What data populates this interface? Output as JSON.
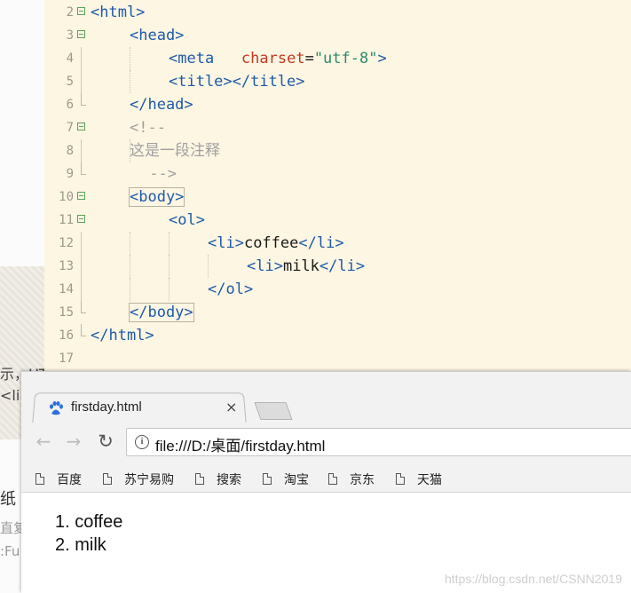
{
  "background": {
    "snippets": [
      "示，HT",
      "<li>",
      "纸",
      "直复",
      ":Fu"
    ]
  },
  "editor": {
    "lines": [
      {
        "num": "2",
        "tokens": [
          {
            "t": "<html>",
            "c": "tag"
          }
        ]
      },
      {
        "num": "3",
        "tokens": [
          {
            "t": "<head>",
            "c": "tag"
          }
        ]
      },
      {
        "num": "4",
        "tokens": [
          {
            "t": "<meta",
            "c": "tag"
          },
          {
            "t": "   ",
            "c": "txt"
          },
          {
            "t": "charset",
            "c": "attr"
          },
          {
            "t": "=",
            "c": "txt"
          },
          {
            "t": "\"utf-8\"",
            "c": "str"
          },
          {
            "t": ">",
            "c": "tag"
          }
        ]
      },
      {
        "num": "5",
        "tokens": [
          {
            "t": "<title></title>",
            "c": "tag"
          }
        ]
      },
      {
        "num": "6",
        "tokens": [
          {
            "t": "</head>",
            "c": "tag"
          }
        ]
      },
      {
        "num": "7",
        "tokens": [
          {
            "t": "<!--",
            "c": "cmt-mono"
          }
        ]
      },
      {
        "num": "8",
        "tokens": [
          {
            "t": "这是一段注释",
            "c": "cmt"
          }
        ]
      },
      {
        "num": "9",
        "tokens": [
          {
            "t": " -->",
            "c": "cmt-mono"
          }
        ]
      },
      {
        "num": "10",
        "tokens": [
          {
            "t": "<body>",
            "c": "tag match"
          }
        ]
      },
      {
        "num": "11",
        "tokens": [
          {
            "t": "<ol>",
            "c": "tag"
          }
        ]
      },
      {
        "num": "12",
        "tokens": [
          {
            "t": "<li>",
            "c": "tag"
          },
          {
            "t": "coffee",
            "c": "txt"
          },
          {
            "t": "</li>",
            "c": "tag"
          }
        ]
      },
      {
        "num": "13",
        "tokens": [
          {
            "t": "<li>",
            "c": "tag"
          },
          {
            "t": "milk",
            "c": "txt"
          },
          {
            "t": "</li>",
            "c": "tag"
          }
        ]
      },
      {
        "num": "14",
        "tokens": [
          {
            "t": "</ol>",
            "c": "tag"
          }
        ]
      },
      {
        "num": "15",
        "tokens": [
          {
            "t": "</body>",
            "c": "tag match"
          }
        ]
      },
      {
        "num": "16",
        "tokens": [
          {
            "t": "</html>",
            "c": "tag"
          }
        ]
      },
      {
        "num": "17",
        "tokens": []
      }
    ]
  },
  "browser": {
    "tab_title": "firstday.html",
    "tab_close": "×",
    "back_glyph": "←",
    "forward_glyph": "→",
    "reload_glyph": "↻",
    "info_glyph": "i",
    "url": "file:///D:/桌面/firstday.html",
    "bookmarks": [
      "百度",
      "苏宁易购",
      "搜索",
      "淘宝",
      "京东",
      "天猫"
    ],
    "page_list": [
      "1. coffee",
      "2. milk"
    ],
    "watermark": "https://blog.csdn.net/CSNN2019"
  },
  "colors": {
    "editor_bg": "#fdf6e3",
    "tag": "#1e5aa8",
    "attr": "#c03a20",
    "string": "#2a8a6e",
    "comment": "#a0a0a0"
  }
}
